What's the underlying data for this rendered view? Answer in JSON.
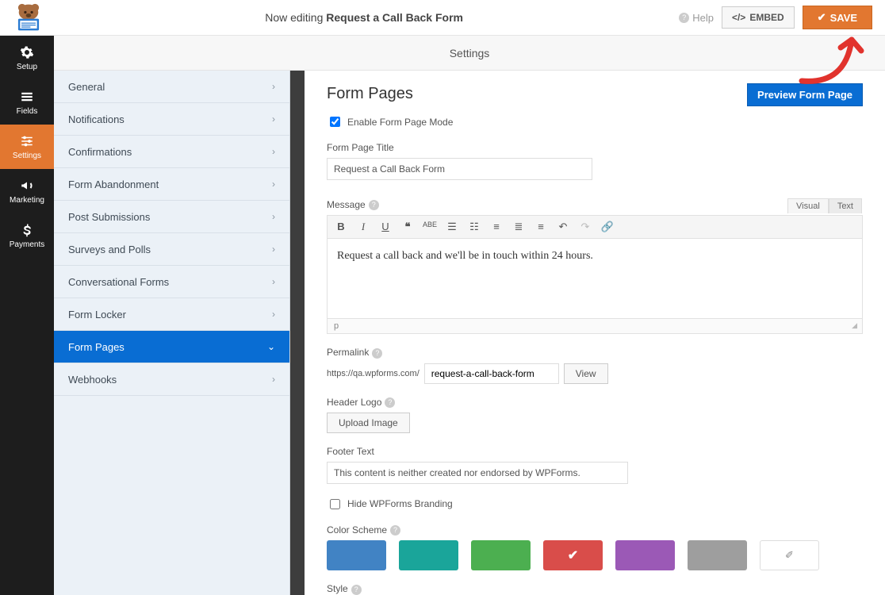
{
  "topbar": {
    "now_editing": "Now editing",
    "form_name": "Request a Call Back Form",
    "help": "Help",
    "embed": "EMBED",
    "save": "SAVE"
  },
  "leftnav": {
    "setup": "Setup",
    "fields": "Fields",
    "settings": "Settings",
    "marketing": "Marketing",
    "payments": "Payments"
  },
  "panel_title": "Settings",
  "settings_items": {
    "0": "General",
    "1": "Notifications",
    "2": "Confirmations",
    "3": "Form Abandonment",
    "4": "Post Submissions",
    "5": "Surveys and Polls",
    "6": "Conversational Forms",
    "7": "Form Locker",
    "8": "Form Pages",
    "9": "Webhooks"
  },
  "form": {
    "heading": "Form Pages",
    "preview_btn": "Preview Form Page",
    "enable_label": "Enable Form Page Mode",
    "title_label": "Form Page Title",
    "title_value": "Request a Call Back Form",
    "message_label": "Message",
    "editor_tabs": {
      "visual": "Visual",
      "text": "Text"
    },
    "message_body": "Request a call back and we'll be in touch within 24 hours.",
    "status_path": "p",
    "permalink_label": "Permalink",
    "permalink_base": "https://qa.wpforms.com/",
    "permalink_slug": "request-a-call-back-form",
    "view_btn": "View",
    "header_logo_label": "Header Logo",
    "upload_btn": "Upload Image",
    "footer_label": "Footer Text",
    "footer_value": "This content is neither created nor endorsed by WPForms.",
    "hide_brand_label": "Hide WPForms Branding",
    "color_label": "Color Scheme",
    "style_label": "Style"
  },
  "colors": {
    "c0": "#4183c4",
    "c1": "#1aa59a",
    "c2": "#4caf50",
    "c3": "#d94d4a",
    "c4": "#9b59b6",
    "c5": "#9e9e9e"
  }
}
